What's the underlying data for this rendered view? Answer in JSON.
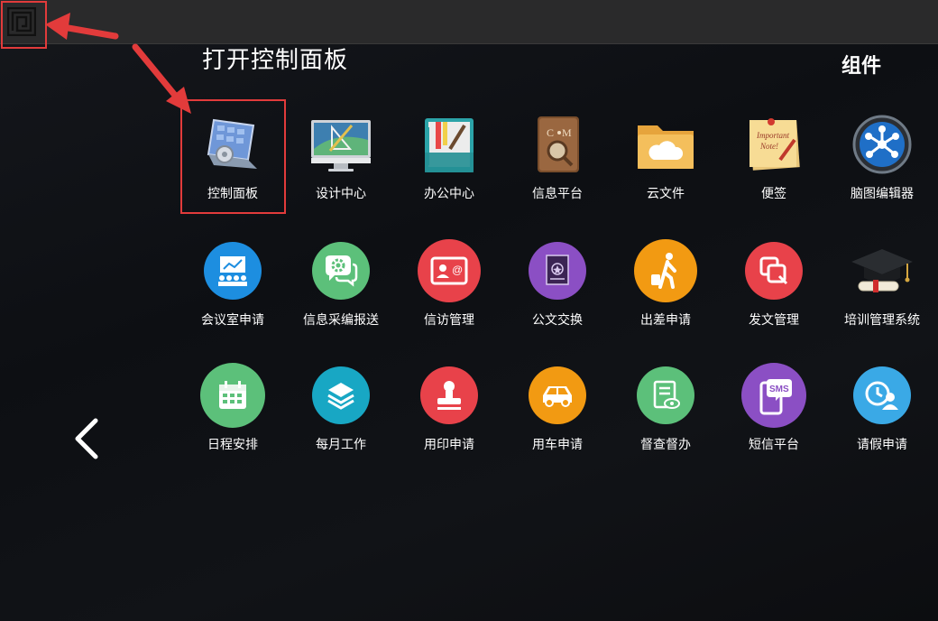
{
  "header": {
    "title": "打开控制面板",
    "widgets_label": "组件"
  },
  "apps_row1": [
    {
      "label": "控制面板",
      "icon": "control-panel-icon"
    },
    {
      "label": "设计中心",
      "icon": "design-monitor-icon"
    },
    {
      "label": "办公中心",
      "icon": "office-notebook-icon"
    },
    {
      "label": "信息平台",
      "icon": "info-book-icon"
    },
    {
      "label": "云文件",
      "icon": "cloud-folder-icon"
    },
    {
      "label": "便签",
      "icon": "sticky-note-icon"
    },
    {
      "label": "脑图编辑器",
      "icon": "mind-map-icon"
    }
  ],
  "apps_row2": [
    {
      "label": "会议室申请",
      "icon": "meeting-room-icon",
      "color": "#1d8ee0"
    },
    {
      "label": "信息采编报送",
      "icon": "chat-gear-icon",
      "color": "#5cc07a"
    },
    {
      "label": "信访管理",
      "icon": "contact-card-icon",
      "color": "#e8424a"
    },
    {
      "label": "公文交换",
      "icon": "document-stamp-icon",
      "color": "#8b4fc4"
    },
    {
      "label": "出差申请",
      "icon": "traveler-icon",
      "color": "#f29a12"
    },
    {
      "label": "发文管理",
      "icon": "copy-docs-icon",
      "color": "#e8424a"
    },
    {
      "label": "培训管理系统",
      "icon": "graduation-cap-icon"
    }
  ],
  "apps_row3": [
    {
      "label": "日程安排",
      "icon": "calendar-icon",
      "color": "#5cc07a"
    },
    {
      "label": "每月工作",
      "icon": "layers-icon",
      "color": "#18a7c4"
    },
    {
      "label": "用印申请",
      "icon": "seal-stamp-icon",
      "color": "#e8424a"
    },
    {
      "label": "用车申请",
      "icon": "car-icon",
      "color": "#f29a12"
    },
    {
      "label": "督查督办",
      "icon": "doc-eye-icon",
      "color": "#5cc07a"
    },
    {
      "label": "短信平台",
      "icon": "sms-phone-icon",
      "color": "#8b4fc4",
      "badge": "SMS"
    },
    {
      "label": "请假申请",
      "icon": "clock-person-icon",
      "color": "#3aa9e6"
    }
  ]
}
